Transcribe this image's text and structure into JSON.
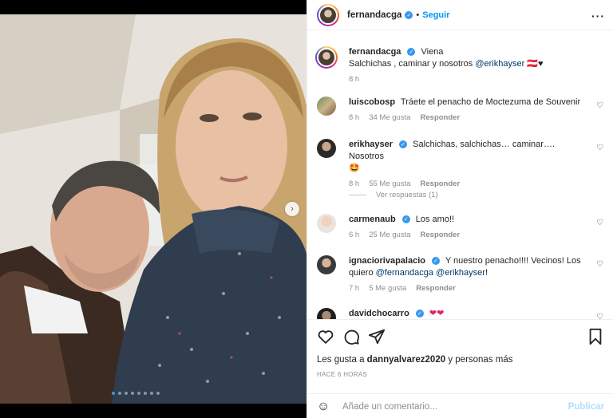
{
  "header": {
    "username": "fernandacga",
    "follow_label": "Seguir"
  },
  "caption": {
    "username": "fernandacga",
    "location": "Viena",
    "text": "Salchichas , caminar y nosotros",
    "mention": "@erikhayser",
    "emoji": "🇦🇹♥",
    "time": "8 h"
  },
  "comments": [
    {
      "username": "luiscobosp",
      "text": "Tráete el penacho de Moctezuma de Souvenir",
      "time": "8 h",
      "likes": "34 Me gusta",
      "reply": "Responder",
      "verified": false
    },
    {
      "username": "erikhayser",
      "text": "Salchichas, salchichas… caminar…. Nosotros",
      "emoji": "🤩",
      "time": "8 h",
      "likes": "55 Me gusta",
      "reply": "Responder",
      "verified": true
    },
    {
      "username": "carmenaub",
      "text": "Los amo!!",
      "time": "6 h",
      "likes": "25 Me gusta",
      "reply": "Responder",
      "verified": true
    },
    {
      "username": "ignaciorivapalacio",
      "text": "Y nuestro penacho!!!! Vecinos! Los quiero",
      "mention1": "@fernandacga",
      "mention2": "@erikhayser",
      "tail": "!",
      "time": "7 h",
      "likes": "5 Me gusta",
      "reply": "Responder",
      "verified": true
    },
    {
      "username": "davidchocarro",
      "text": "❤❤",
      "verified": true
    }
  ],
  "view_replies": "Ver respuestas (1)",
  "likes_line": {
    "prefix": "Les gusta a",
    "user": "dannyalvarez2020",
    "suffix": "y personas más"
  },
  "posted_ago": "HACE 6 HORAS",
  "composer": {
    "placeholder": "Añade un comentario...",
    "publish_label": "Publicar"
  },
  "icons": {
    "like": "heart-icon",
    "comment": "comment-icon",
    "share": "paper-plane-icon",
    "save": "bookmark-icon",
    "emoji": "smiley-icon",
    "more": "ellipsis-icon"
  },
  "colors": {
    "accent": "#0095f6",
    "verified": "#3897f0",
    "muted": "#8e8e8e",
    "publish_disabled": "#b2dffc"
  }
}
